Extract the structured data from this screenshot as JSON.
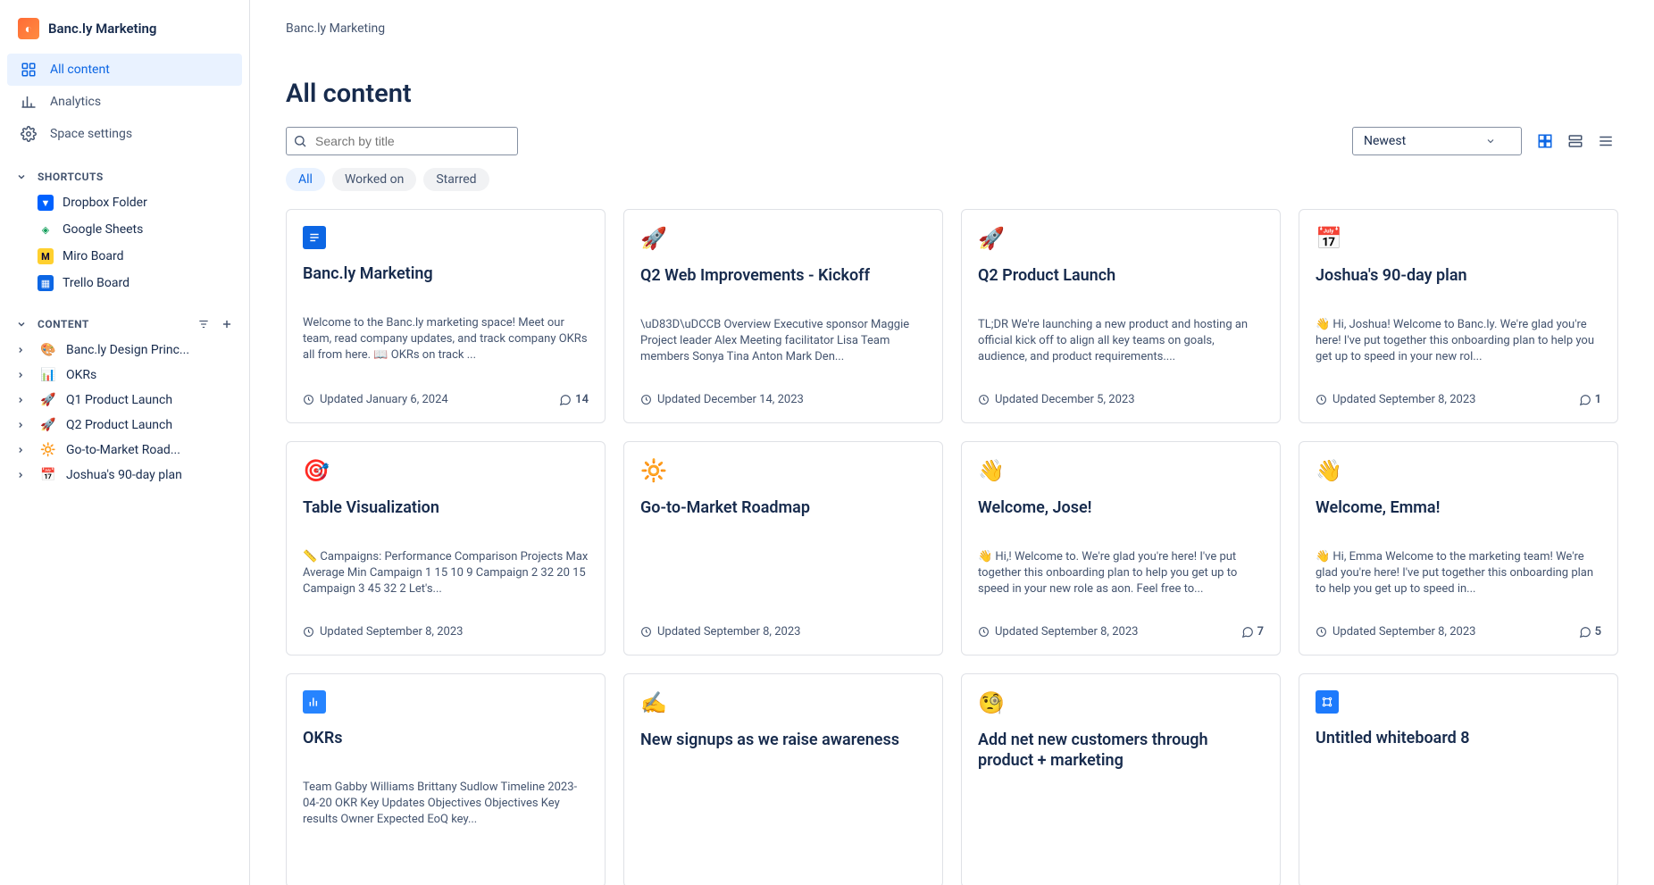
{
  "space": {
    "name": "Banc.ly Marketing"
  },
  "breadcrumb": "Banc.ly Marketing",
  "page_title": "All content",
  "sidebar": {
    "nav": [
      {
        "label": "All content",
        "icon": "grid",
        "active": true
      },
      {
        "label": "Analytics",
        "icon": "analytics",
        "active": false
      },
      {
        "label": "Space settings",
        "icon": "gear",
        "active": false
      }
    ],
    "shortcuts_label": "SHORTCUTS",
    "shortcuts": [
      {
        "label": "Dropbox Folder",
        "icon": "dropbox"
      },
      {
        "label": "Google Sheets",
        "icon": "sheets"
      },
      {
        "label": "Miro Board",
        "icon": "miro"
      },
      {
        "label": "Trello Board",
        "icon": "trello"
      }
    ],
    "content_label": "CONTENT",
    "tree": [
      {
        "label": "Banc.ly Design Princ...",
        "icon": "🎨"
      },
      {
        "label": "OKRs",
        "icon": "📊"
      },
      {
        "label": "Q1 Product Launch",
        "icon": "🚀"
      },
      {
        "label": "Q2 Product Launch",
        "icon": "🚀"
      },
      {
        "label": "Go-to-Market Road...",
        "icon": "🔆"
      },
      {
        "label": "Joshua's 90-day plan",
        "icon": "📅"
      }
    ]
  },
  "search": {
    "placeholder": "Search by title"
  },
  "sort": {
    "selected": "Newest"
  },
  "filters": [
    {
      "label": "All",
      "active": true
    },
    {
      "label": "Worked on",
      "active": false
    },
    {
      "label": "Starred",
      "active": false
    }
  ],
  "cards": [
    {
      "icon_type": "doc",
      "icon": "",
      "title": "Banc.ly Marketing",
      "excerpt": "Welcome to the Banc.ly marketing space! Meet our team, read company updates, and track company OKRs all from here. 📖 OKRs on track ...",
      "updated": "Updated January 6, 2024",
      "comments": "14"
    },
    {
      "icon_type": "emoji",
      "icon": "🚀",
      "title": "Q2 Web Improvements - Kickoff",
      "excerpt": "\\uD83D\\uDCCB  Overview Executive sponsor Maggie Project leader Alex Meeting facilitator Lisa Team members Sonya Tina Anton Mark Den...",
      "updated": "Updated December 14, 2023",
      "comments": ""
    },
    {
      "icon_type": "emoji",
      "icon": "🚀",
      "title": "Q2 Product Launch",
      "excerpt": "TL;DR We're launching a new product and hosting an official kick off to align all key teams on goals, audience, and product requirements....",
      "updated": "Updated December 5, 2023",
      "comments": ""
    },
    {
      "icon_type": "emoji",
      "icon": "📅",
      "title": "Joshua's 90-day plan",
      "excerpt": "👋  Hi, Joshua! Welcome to Banc.ly. We're glad you're here! I've put together this onboarding plan to help you get up to speed in your new rol...",
      "updated": "Updated September 8, 2023",
      "comments": "1"
    },
    {
      "icon_type": "emoji",
      "icon": "🎯",
      "title": "Table Visualization",
      "excerpt": "📏  Campaigns: Performance Comparison Projects Max Average Min Campaign 1 15 10 9 Campaign 2 32 20 15 Campaign 3 45 32 2 Let's...",
      "updated": "Updated September 8, 2023",
      "comments": ""
    },
    {
      "icon_type": "emoji",
      "icon": "🔆",
      "title": "Go-to-Market Roadmap",
      "excerpt": "",
      "updated": "Updated September 8, 2023",
      "comments": ""
    },
    {
      "icon_type": "emoji",
      "icon": "👋",
      "title": "Welcome, Jose!",
      "excerpt": "👋  Hi,! Welcome to. We're glad you're here! I've put together this onboarding plan to help you get up to speed in your new role as aon. Feel free to...",
      "updated": "Updated September 8, 2023",
      "comments": "7"
    },
    {
      "icon_type": "emoji",
      "icon": "👋",
      "title": "Welcome, Emma!",
      "excerpt": "👋 Hi, Emma Welcome to the marketing team! We're glad you're here! I've put together this onboarding plan to help you get up to speed in...",
      "updated": "Updated September 8, 2023",
      "comments": "5"
    },
    {
      "icon_type": "okr",
      "icon": "",
      "title": "OKRs",
      "excerpt": "Team Gabby Williams Brittany Sudlow Timeline 2023-04-20 OKR Key Updates Objectives Objectives Key results Owner Expected EoQ key...",
      "updated": "",
      "comments": ""
    },
    {
      "icon_type": "emoji",
      "icon": "✍️",
      "title": "New signups as we raise awareness",
      "excerpt": "",
      "updated": "",
      "comments": ""
    },
    {
      "icon_type": "emoji",
      "icon": "🧐",
      "title": "Add net new customers through product + marketing",
      "excerpt": "",
      "updated": "",
      "comments": ""
    },
    {
      "icon_type": "wb",
      "icon": "",
      "title": "Untitled whiteboard 8",
      "excerpt": "",
      "updated": "",
      "comments": ""
    }
  ]
}
